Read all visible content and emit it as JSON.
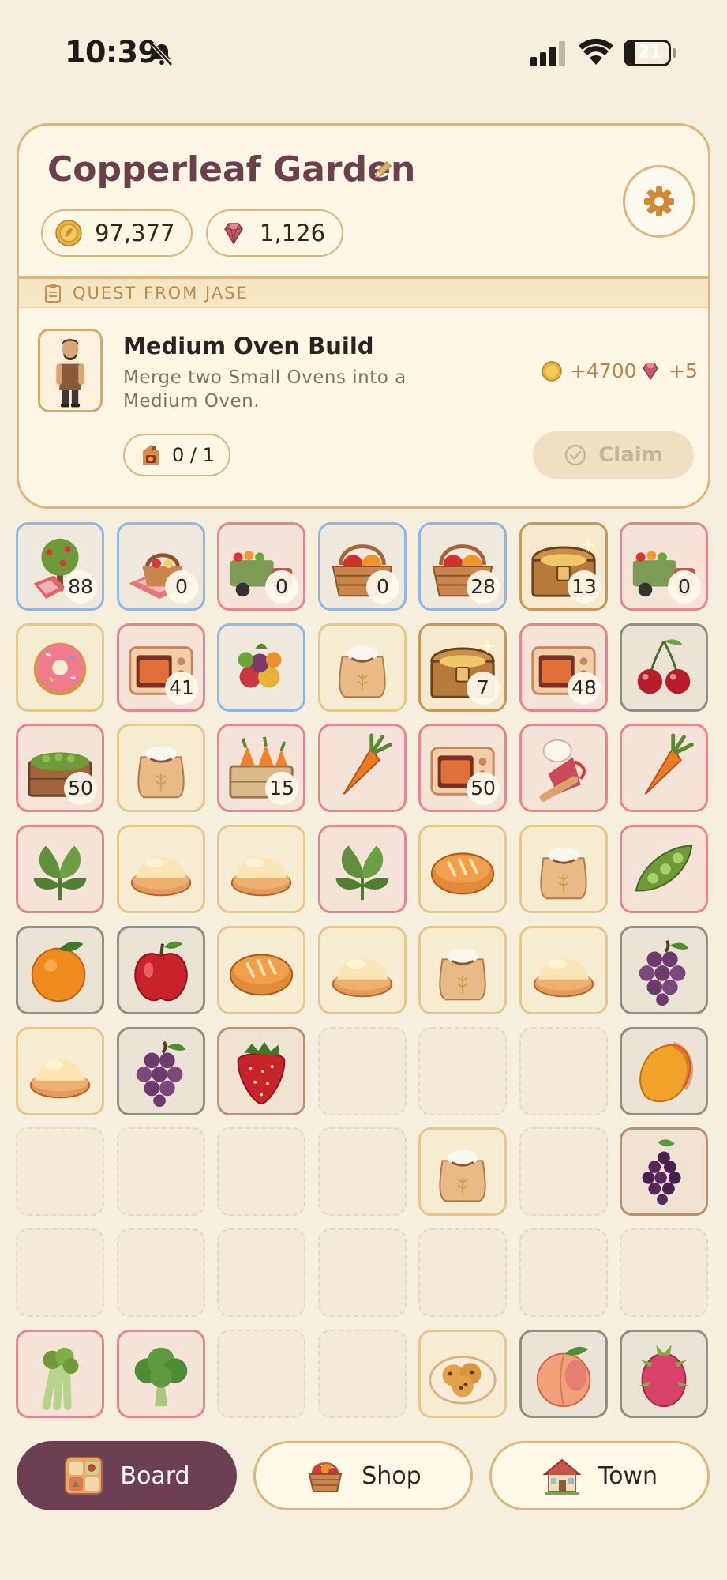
{
  "status_bar": {
    "time": "10:39",
    "battery": "21",
    "battery_level": 0.21
  },
  "header": {
    "title": "Copperleaf Garden",
    "coins": "97,377",
    "gems": "1,126"
  },
  "quest": {
    "section_label": "QUEST FROM JASE",
    "title": "Medium Oven Build",
    "description": "Merge two Small Ovens into a Medium Oven.",
    "reward_coins": "+4700",
    "reward_gems": "+5",
    "progress": "0 / 1",
    "claim_label": "Claim"
  },
  "board": {
    "rows": [
      [
        {
          "item": "orchard-tree",
          "frame": "blue",
          "count": "88"
        },
        {
          "item": "picnic-basket",
          "frame": "blue",
          "count": "0"
        },
        {
          "item": "produce-truck",
          "frame": "pink",
          "count": "0"
        },
        {
          "item": "fruit-basket",
          "frame": "blue",
          "count": "0"
        },
        {
          "item": "fruit-basket",
          "frame": "blue",
          "count": "28"
        },
        {
          "item": "treasure-chest",
          "frame": "gold",
          "count": "13"
        },
        {
          "item": "produce-truck",
          "frame": "pink",
          "count": "0"
        }
      ],
      [
        {
          "item": "donut",
          "frame": "tan"
        },
        {
          "item": "oven",
          "frame": "pink",
          "count": "41"
        },
        {
          "item": "fruit-pile",
          "frame": "blue"
        },
        {
          "item": "flour-sack",
          "frame": "tan"
        },
        {
          "item": "treasure-chest",
          "frame": "gold",
          "count": "7"
        },
        {
          "item": "oven",
          "frame": "pink",
          "count": "48"
        },
        {
          "item": "cherries",
          "frame": "gray"
        }
      ],
      [
        {
          "item": "pea-crate",
          "frame": "pink",
          "count": "50"
        },
        {
          "item": "flour-sack",
          "frame": "tan"
        },
        {
          "item": "carrot-crate",
          "frame": "pink",
          "count": "15"
        },
        {
          "item": "carrot",
          "frame": "pink"
        },
        {
          "item": "oven",
          "frame": "pink",
          "count": "50"
        },
        {
          "item": "baker-kit",
          "frame": "pink"
        },
        {
          "item": "carrot",
          "frame": "pink"
        }
      ],
      [
        {
          "item": "spinach",
          "frame": "pink"
        },
        {
          "item": "dough",
          "frame": "tan"
        },
        {
          "item": "dough",
          "frame": "tan"
        },
        {
          "item": "spinach",
          "frame": "pink"
        },
        {
          "item": "bread-loaf",
          "frame": "tan"
        },
        {
          "item": "flour-sack",
          "frame": "tan"
        },
        {
          "item": "pea-pod",
          "frame": "pink"
        }
      ],
      [
        {
          "item": "orange",
          "frame": "gray"
        },
        {
          "item": "apple",
          "frame": "gray"
        },
        {
          "item": "bread-loaf",
          "frame": "tan"
        },
        {
          "item": "dough",
          "frame": "tan"
        },
        {
          "item": "flour-sack",
          "frame": "tan"
        },
        {
          "item": "dough",
          "frame": "tan"
        },
        {
          "item": "grapes",
          "frame": "gray"
        }
      ],
      [
        {
          "item": "dough",
          "frame": "tan"
        },
        {
          "item": "grapes",
          "frame": "gray"
        },
        {
          "item": "strawberry",
          "frame": "brown"
        },
        {
          "item": "empty"
        },
        {
          "item": "empty"
        },
        {
          "item": "empty"
        },
        {
          "item": "mango",
          "frame": "gray"
        }
      ],
      [
        {
          "item": "empty"
        },
        {
          "item": "empty"
        },
        {
          "item": "empty"
        },
        {
          "item": "empty"
        },
        {
          "item": "flour-sack",
          "frame": "tan"
        },
        {
          "item": "empty"
        },
        {
          "item": "blackberry",
          "frame": "brown"
        }
      ],
      [
        {
          "item": "empty"
        },
        {
          "item": "empty"
        },
        {
          "item": "empty"
        },
        {
          "item": "empty"
        },
        {
          "item": "empty"
        },
        {
          "item": "empty"
        },
        {
          "item": "empty"
        }
      ],
      [
        {
          "item": "celery",
          "frame": "pink"
        },
        {
          "item": "broccoli",
          "frame": "pink"
        },
        {
          "item": "empty"
        },
        {
          "item": "empty"
        },
        {
          "item": "cookie-plate",
          "frame": "tan"
        },
        {
          "item": "peach",
          "frame": "gray"
        },
        {
          "item": "dragon-fruit",
          "frame": "gray"
        }
      ]
    ]
  },
  "nav": {
    "board_label": "Board",
    "shop_label": "Shop",
    "town_label": "Town"
  },
  "colors": {
    "accent": "#6d3f53",
    "frame_gold": "#dcb77c",
    "background": "#f6efdd"
  }
}
